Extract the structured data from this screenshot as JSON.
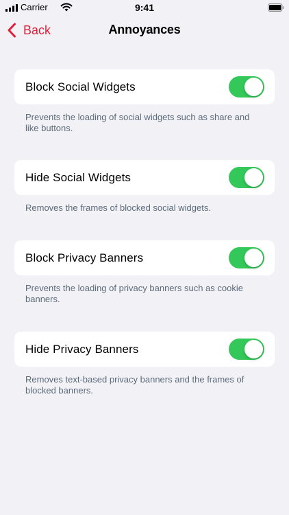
{
  "status_bar": {
    "carrier": "Carrier",
    "time": "9:41",
    "signal_icon": "signal-bars-icon",
    "wifi_icon": "wifi-icon",
    "battery_icon": "battery-icon"
  },
  "nav": {
    "back_label": "Back",
    "back_icon": "chevron-left-icon",
    "title": "Annoyances"
  },
  "colors": {
    "accent": "#e01e3a",
    "toggle_on": "#34c759",
    "background": "#f2f2f6",
    "footer_text": "#5c6b7a"
  },
  "settings": [
    {
      "label": "Block Social Widgets",
      "enabled": true,
      "description": "Prevents the loading of social widgets such as share and like buttons."
    },
    {
      "label": "Hide Social Widgets",
      "enabled": true,
      "description": "Removes the frames of blocked social widgets."
    },
    {
      "label": "Block Privacy Banners",
      "enabled": true,
      "description": "Prevents the loading of privacy banners such as cookie banners."
    },
    {
      "label": "Hide Privacy Banners",
      "enabled": true,
      "description": "Removes text-based privacy banners and the frames of blocked banners."
    }
  ]
}
